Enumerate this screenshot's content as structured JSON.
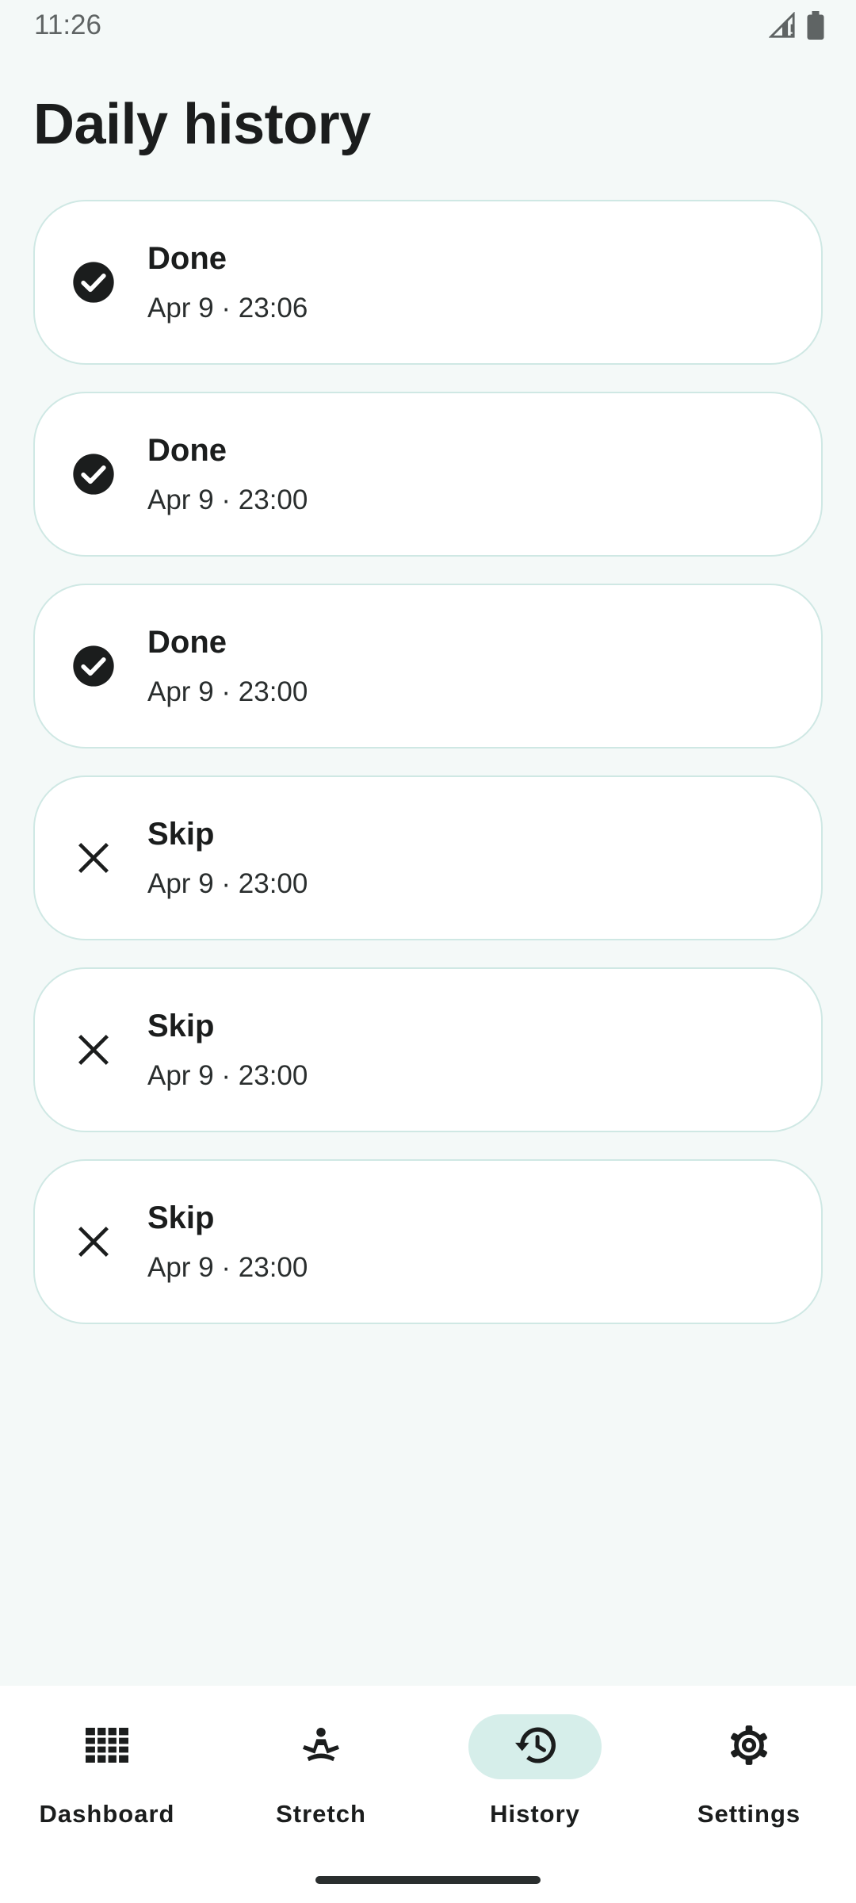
{
  "status_bar": {
    "time": "11:26",
    "icons": [
      "signal-icon",
      "battery-icon"
    ]
  },
  "page": {
    "title": "Daily history"
  },
  "history": [
    {
      "status": "Done",
      "time": "Apr 9 · 23:06",
      "icon": "check-circle-icon"
    },
    {
      "status": "Done",
      "time": "Apr 9 · 23:00",
      "icon": "check-circle-icon"
    },
    {
      "status": "Done",
      "time": "Apr 9 · 23:00",
      "icon": "check-circle-icon"
    },
    {
      "status": "Skip",
      "time": "Apr 9 · 23:00",
      "icon": "close-icon"
    },
    {
      "status": "Skip",
      "time": "Apr 9 · 23:00",
      "icon": "close-icon"
    },
    {
      "status": "Skip",
      "time": "Apr 9 · 23:00",
      "icon": "close-icon"
    }
  ],
  "nav": {
    "items": [
      {
        "label": "Dashboard",
        "icon": "grid-icon",
        "active": false
      },
      {
        "label": "Stretch",
        "icon": "stretch-figure-icon",
        "active": false
      },
      {
        "label": "History",
        "icon": "history-clock-icon",
        "active": true
      },
      {
        "label": "Settings",
        "icon": "gear-icon",
        "active": false
      }
    ]
  },
  "colors": {
    "background": "#f4f9f8",
    "card": "#ffffff",
    "card_border": "#cfe8e4",
    "active_pill": "#d6eeea",
    "text": "#1b1d1d"
  }
}
